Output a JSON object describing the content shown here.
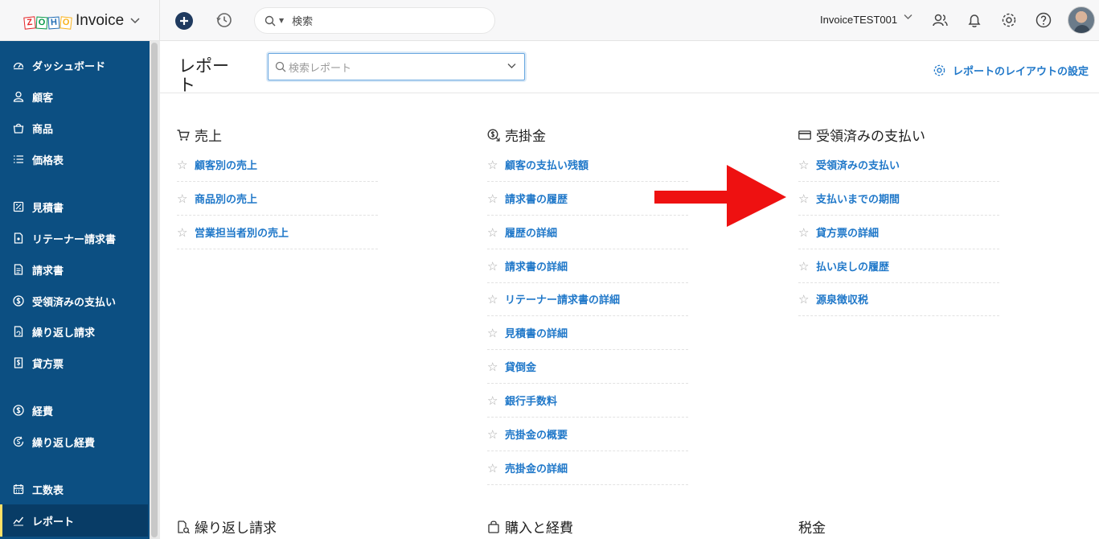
{
  "topbar": {
    "logo_letters": [
      "Z",
      "O",
      "H",
      "O"
    ],
    "brand": "Invoice",
    "search_placeholder": "検索",
    "org_name": "InvoiceTEST001"
  },
  "sidebar": {
    "items": [
      {
        "label": "ダッシュボード",
        "icon": "dashboard-icon"
      },
      {
        "label": "顧客",
        "icon": "customer-icon"
      },
      {
        "label": "商品",
        "icon": "items-icon"
      },
      {
        "label": "価格表",
        "icon": "price-list-icon"
      },
      {
        "label": "見積書",
        "icon": "estimate-icon"
      },
      {
        "label": "リテーナー請求書",
        "icon": "retainer-invoice-icon"
      },
      {
        "label": "請求書",
        "icon": "invoice-icon"
      },
      {
        "label": "受領済みの支払い",
        "icon": "payment-received-icon"
      },
      {
        "label": "繰り返し請求",
        "icon": "recurring-invoice-icon"
      },
      {
        "label": "貸方票",
        "icon": "credit-note-icon"
      },
      {
        "label": "経費",
        "icon": "expense-icon"
      },
      {
        "label": "繰り返し経費",
        "icon": "recurring-expense-icon"
      },
      {
        "label": "工数表",
        "icon": "timesheet-icon"
      },
      {
        "label": "レポート",
        "icon": "reports-icon",
        "active": true
      }
    ]
  },
  "page": {
    "title": "レポート",
    "search_placeholder": "検索レポート",
    "layout_link": "レポートのレイアウトの設定"
  },
  "sections": [
    {
      "title": "売上",
      "icon": "cart-icon",
      "items": [
        "顧客別の売上",
        "商品別の売上",
        "営業担当者別の売上"
      ]
    },
    {
      "title": "売掛金",
      "icon": "receivables-icon",
      "items": [
        "顧客の支払い残額",
        "請求書の履歴",
        "履歴の詳細",
        "請求書の詳細",
        "リテーナー請求書の詳細",
        "見積書の詳細",
        "貸倒金",
        "銀行手数料",
        "売掛金の概要",
        "売掛金の詳細"
      ]
    },
    {
      "title": "受領済みの支払い",
      "icon": "card-icon",
      "items": [
        "受領済みの支払い",
        "支払いまでの期間",
        "貸方票の詳細",
        "払い戻しの履歴",
        "源泉徴収税"
      ]
    },
    {
      "title": "繰り返し請求",
      "icon": "recurring-doc-icon",
      "items": []
    },
    {
      "title": "購入と経費",
      "icon": "bag-icon",
      "items": []
    },
    {
      "title": "税金",
      "icon": "",
      "items": []
    }
  ],
  "colors": {
    "sidebar_bg": "#0c4f82",
    "link": "#2078c9",
    "annotation_arrow": "#ee1111"
  }
}
